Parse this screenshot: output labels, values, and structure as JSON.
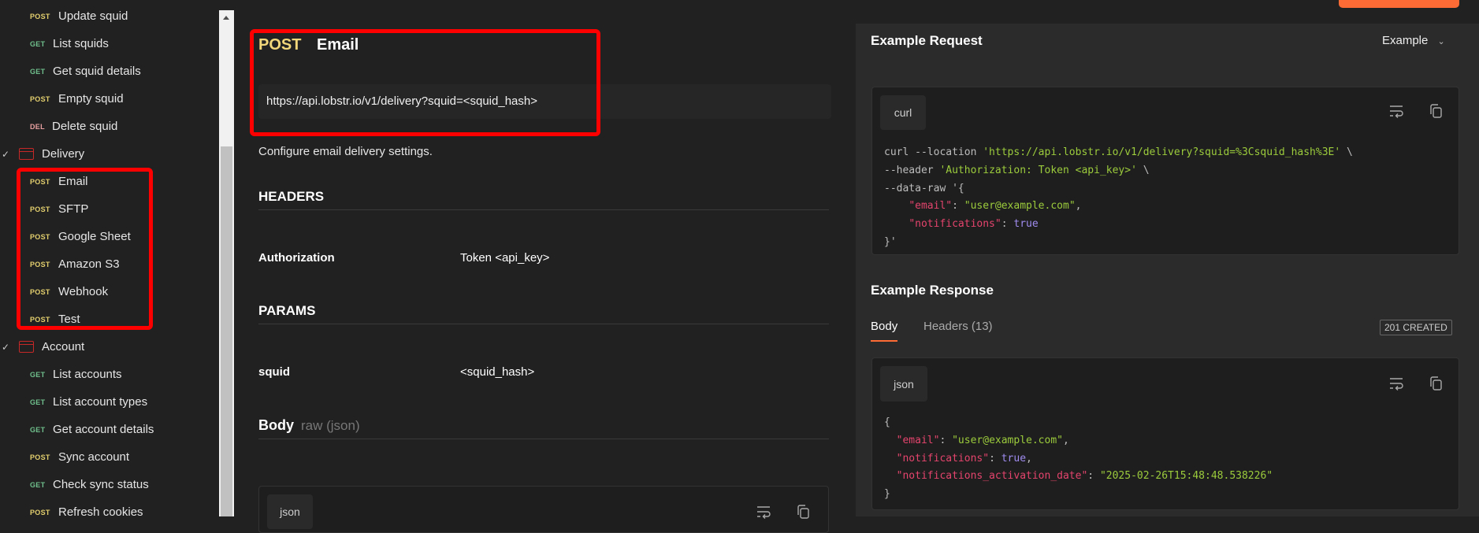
{
  "sidebar": {
    "items": [
      {
        "type": "request",
        "method": "POST",
        "label": "Update squid"
      },
      {
        "type": "request",
        "method": "GET",
        "label": "List squids"
      },
      {
        "type": "request",
        "method": "GET",
        "label": "Get squid details"
      },
      {
        "type": "request",
        "method": "POST",
        "label": "Empty squid"
      },
      {
        "type": "request",
        "method": "DEL",
        "label": "Delete squid"
      },
      {
        "type": "folder",
        "label": "Delivery"
      },
      {
        "type": "request",
        "method": "POST",
        "label": "Email"
      },
      {
        "type": "request",
        "method": "POST",
        "label": "SFTP"
      },
      {
        "type": "request",
        "method": "POST",
        "label": "Google Sheet"
      },
      {
        "type": "request",
        "method": "POST",
        "label": "Amazon S3"
      },
      {
        "type": "request",
        "method": "POST",
        "label": "Webhook"
      },
      {
        "type": "request",
        "method": "POST",
        "label": "Test"
      },
      {
        "type": "folder",
        "label": "Account"
      },
      {
        "type": "request",
        "method": "GET",
        "label": "List accounts"
      },
      {
        "type": "request",
        "method": "GET",
        "label": "List account types"
      },
      {
        "type": "request",
        "method": "GET",
        "label": "Get account details"
      },
      {
        "type": "request",
        "method": "POST",
        "label": "Sync account"
      },
      {
        "type": "request",
        "method": "GET",
        "label": "Check sync status"
      },
      {
        "type": "request",
        "method": "POST",
        "label": "Refresh cookies"
      }
    ]
  },
  "endpoint": {
    "method": "POST",
    "name": "Email",
    "url": "https://api.lobstr.io/v1/delivery?squid=<squid_hash>",
    "description": "Configure email delivery settings.",
    "headers_title": "HEADERS",
    "headers": [
      {
        "key": "Authorization",
        "value": "Token <api_key>"
      }
    ],
    "params_title": "PARAMS",
    "params": [
      {
        "key": "squid",
        "value": "<squid_hash>"
      }
    ],
    "body_title": "Body",
    "body_type": "raw (json)",
    "body_lang": "json"
  },
  "example_request": {
    "title": "Example Request",
    "selector": "Example",
    "lang": "curl",
    "lines": [
      [
        [
          "p",
          "curl --location "
        ],
        [
          "s",
          "'https://api.lobstr.io/v1/delivery?squid=%3Csquid_hash%3E'"
        ],
        [
          "p",
          " \\"
        ]
      ],
      [
        [
          "p",
          "--header "
        ],
        [
          "s",
          "'Authorization: Token <api_key>'"
        ],
        [
          "p",
          " \\"
        ]
      ],
      [
        [
          "p",
          "--data-raw '{"
        ]
      ],
      [
        [
          "p",
          "    "
        ],
        [
          "k",
          "\"email\""
        ],
        [
          "p",
          ": "
        ],
        [
          "s",
          "\"user@example.com\""
        ],
        [
          "p",
          ","
        ]
      ],
      [
        [
          "p",
          "    "
        ],
        [
          "k",
          "\"notifications\""
        ],
        [
          "p",
          ": "
        ],
        [
          "b",
          "true"
        ]
      ],
      [
        [
          "p",
          "}'"
        ]
      ]
    ]
  },
  "example_response": {
    "title": "Example Response",
    "tabs": [
      "Body",
      "Headers (13)"
    ],
    "status": "201 CREATED",
    "lang": "json",
    "lines": [
      [
        [
          "p",
          "{"
        ]
      ],
      [
        [
          "p",
          "  "
        ],
        [
          "k",
          "\"email\""
        ],
        [
          "p",
          ": "
        ],
        [
          "s",
          "\"user@example.com\""
        ],
        [
          "p",
          ","
        ]
      ],
      [
        [
          "p",
          "  "
        ],
        [
          "k",
          "\"notifications\""
        ],
        [
          "p",
          ": "
        ],
        [
          "b",
          "true"
        ],
        [
          "p",
          ","
        ]
      ],
      [
        [
          "p",
          "  "
        ],
        [
          "k",
          "\"notifications_activation_date\""
        ],
        [
          "p",
          ": "
        ],
        [
          "s",
          "\"2025-02-26T15:48:48.538226\""
        ]
      ],
      [
        [
          "p",
          "}"
        ]
      ]
    ]
  },
  "colors": {
    "accent": "#ff6b35",
    "highlight": "#ff0000",
    "post": "#e3cf6e",
    "get": "#6fc08c"
  }
}
